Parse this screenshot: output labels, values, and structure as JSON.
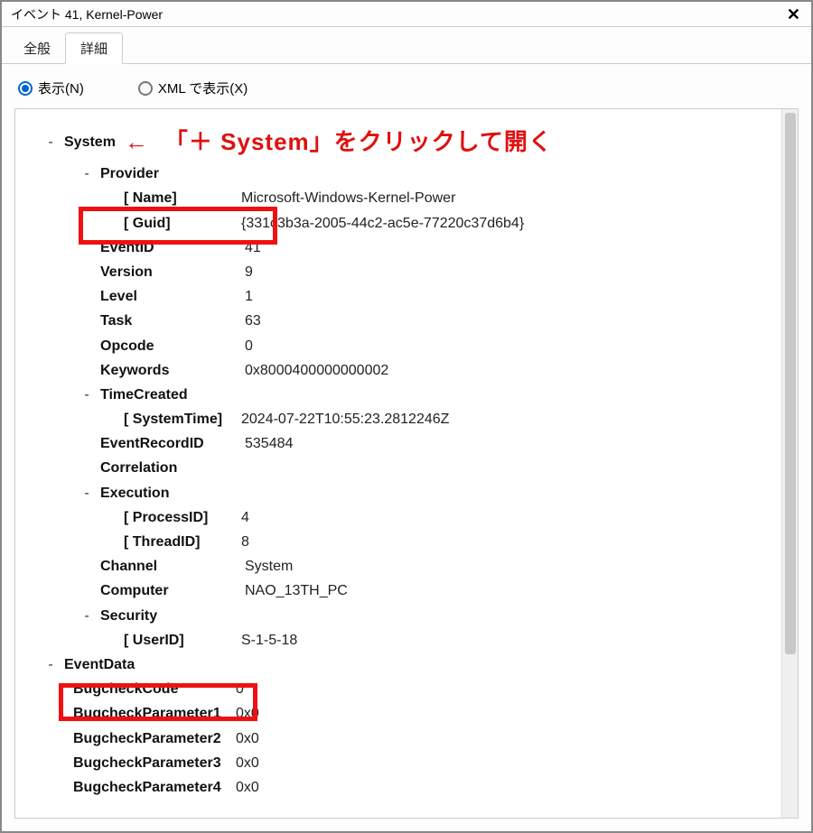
{
  "titlebar": {
    "title": "イベント 41, Kernel-Power"
  },
  "tabs": {
    "general": "全般",
    "details": "詳細"
  },
  "radios": {
    "friendly": "表示(N)",
    "xml": "XML で表示(X)"
  },
  "annotation": {
    "arrow": "←",
    "text": "「＋ System」をクリックして開く"
  },
  "tree": {
    "system": {
      "label": "System",
      "provider": {
        "label": "Provider",
        "name_key": "[ Name]",
        "name_val": "Microsoft-Windows-Kernel-Power",
        "guid_key": "[ Guid]",
        "guid_val": "{331c3b3a-2005-44c2-ac5e-77220c37d6b4}"
      },
      "eventid": {
        "key": "EventID",
        "val": "41"
      },
      "version": {
        "key": "Version",
        "val": "9"
      },
      "level": {
        "key": "Level",
        "val": "1"
      },
      "task": {
        "key": "Task",
        "val": "63"
      },
      "opcode": {
        "key": "Opcode",
        "val": "0"
      },
      "keywords": {
        "key": "Keywords",
        "val": "0x8000400000000002"
      },
      "timecreated": {
        "label": "TimeCreated",
        "systime_key": "[ SystemTime]",
        "systime_val": "2024-07-22T10:55:23.2812246Z"
      },
      "recordid": {
        "key": "EventRecordID",
        "val": "535484"
      },
      "correlation": {
        "key": "Correlation",
        "val": ""
      },
      "execution": {
        "label": "Execution",
        "pid_key": "[ ProcessID]",
        "pid_val": "4",
        "tid_key": "[ ThreadID]",
        "tid_val": "8"
      },
      "channel": {
        "key": "Channel",
        "val": "System"
      },
      "computer": {
        "key": "Computer",
        "val": "NAO_13TH_PC"
      },
      "security": {
        "label": "Security",
        "uid_key": "[ UserID]",
        "uid_val": "S-1-5-18"
      }
    },
    "eventdata": {
      "label": "EventData",
      "bugcode": {
        "key": "BugcheckCode",
        "val": "0"
      },
      "bp1": {
        "key": "BugcheckParameter1",
        "val": "0x0"
      },
      "bp2": {
        "key": "BugcheckParameter2",
        "val": "0x0"
      },
      "bp3": {
        "key": "BugcheckParameter3",
        "val": "0x0"
      },
      "bp4": {
        "key": "BugcheckParameter4",
        "val": "0x0"
      }
    }
  },
  "sym": {
    "minus": "-",
    "plus": "+"
  }
}
